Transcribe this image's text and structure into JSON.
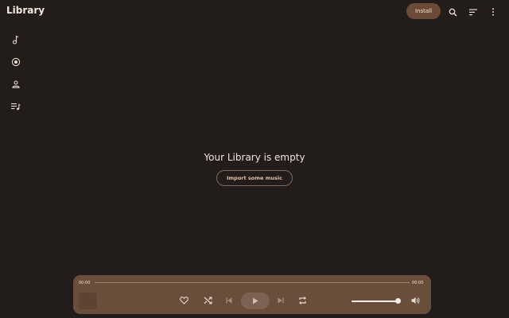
{
  "app": {
    "title": "Library"
  },
  "header": {
    "install_label": "Install",
    "icons": [
      "search-icon",
      "sort-icon",
      "more-vert-icon"
    ]
  },
  "nav_rail": {
    "items": [
      {
        "icon": "music-note-icon",
        "name": "songs"
      },
      {
        "icon": "album-icon",
        "name": "albums"
      },
      {
        "icon": "person-icon",
        "name": "artists"
      },
      {
        "icon": "playlist-icon",
        "name": "playlists"
      }
    ]
  },
  "empty_state": {
    "title": "Your Library is empty",
    "action_label": "Import some music"
  },
  "player": {
    "current_time": "00:00",
    "duration": "00:00",
    "progress": 0,
    "volume": 0.95,
    "controls": [
      "favorite-icon",
      "shuffle-icon",
      "skip-previous-icon",
      "play-icon",
      "skip-next-icon",
      "repeat-icon",
      "volume-icon"
    ]
  },
  "colors": {
    "background": "#221c1a",
    "player_bg": "#6a4e3c",
    "accent": "#e8bfa2",
    "install_bg": "#6b4b37"
  }
}
